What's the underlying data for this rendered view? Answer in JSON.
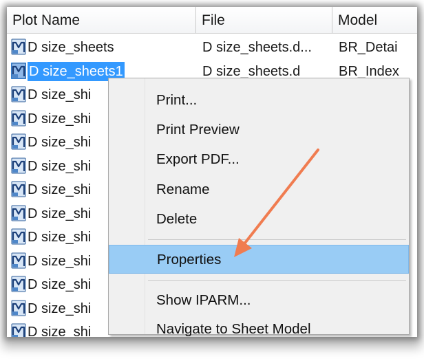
{
  "columns": {
    "name": "Plot Name",
    "file": "File",
    "model": "Model"
  },
  "rows": [
    {
      "name": "D size_sheets",
      "file": "D size_sheets.d...",
      "model": "BR_Detai",
      "selected": false
    },
    {
      "name": "D size_sheets1",
      "file": "D size_sheets.d",
      "model": "BR_Index",
      "selected": true
    },
    {
      "name": "D size_shi",
      "file": "",
      "model": "",
      "selected": false
    },
    {
      "name": "D size_shi",
      "file": "",
      "model": "",
      "selected": false
    },
    {
      "name": "D size_shi",
      "file": "",
      "model": "",
      "selected": false
    },
    {
      "name": "D size_shi",
      "file": "",
      "model": "",
      "selected": false
    },
    {
      "name": "D size_shi",
      "file": "",
      "model": "",
      "selected": false
    },
    {
      "name": "D size_shi",
      "file": "",
      "model": "",
      "selected": false
    },
    {
      "name": "D size_shi",
      "file": "",
      "model": "",
      "selected": false
    },
    {
      "name": "D size_shi",
      "file": "",
      "model": "",
      "selected": false
    },
    {
      "name": "D size_shi",
      "file": "",
      "model": "",
      "selected": false
    },
    {
      "name": "D size_shi",
      "file": "",
      "model": "",
      "selected": false
    },
    {
      "name": "D size_shi",
      "file": "",
      "model": "",
      "selected": false
    }
  ],
  "icons": {
    "row": "plot-document-icon"
  },
  "context_menu": {
    "items": [
      {
        "label": "Print...",
        "highlighted": false
      },
      {
        "label": "Print Preview",
        "highlighted": false
      },
      {
        "label": "Export PDF...",
        "highlighted": false
      },
      {
        "label": "Rename",
        "highlighted": false
      },
      {
        "label": "Delete",
        "highlighted": false
      },
      {
        "label": "Properties",
        "highlighted": true
      },
      {
        "label": "Show IPARM...",
        "highlighted": false
      },
      {
        "label": "Navigate to Sheet Model",
        "highlighted": false
      }
    ]
  },
  "colors": {
    "selection": "#3399ff",
    "menu_highlight": "#99ccf5",
    "annotation_arrow": "#f07c50"
  }
}
